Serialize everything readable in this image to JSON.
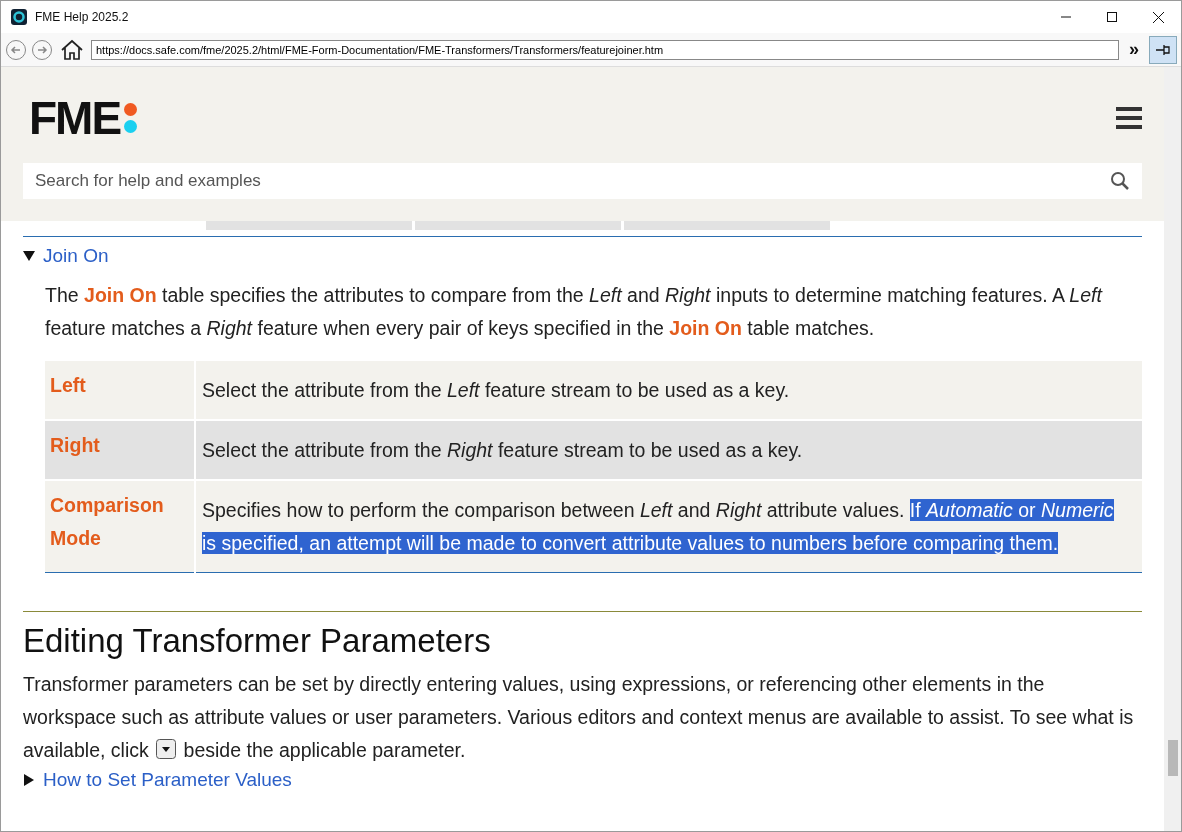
{
  "window": {
    "title": "FME Help 2025.2"
  },
  "toolbar": {
    "url": "https://docs.safe.com/fme/2025.2/html/FME-Form-Documentation/FME-Transformers/Transformers/featurejoiner.htm",
    "overflow": "»"
  },
  "header": {
    "logo": "FME",
    "search": {
      "placeholder": "Search for help and examples"
    }
  },
  "section": {
    "title": "Join On",
    "expanded": true,
    "intro": "The **Join On** table specifies the attributes to compare from the *Left* and *Right* inputs to determine matching features. A *Left* feature matches a *Right* feature when every pair of keys specified in the **Join On** table matches.",
    "rows": [
      {
        "name": "Left",
        "segments": [
          {
            "text": "Select the attribute from the *Left* feature stream to be used as a key.",
            "selected": false
          }
        ]
      },
      {
        "name": "Right",
        "segments": [
          {
            "text": "Select the attribute from the *Right* feature stream to be used as a key.",
            "selected": false
          }
        ]
      },
      {
        "name": "Comparison Mode",
        "segments": [
          {
            "text": "Specifies how to perform the comparison between *Left* and *Right* attribute values. ",
            "selected": false
          },
          {
            "text": "If *Automatic* or *Numeric* is specified, an attempt will be made to convert attribute values to numbers before comparing them.",
            "selected": true
          }
        ]
      }
    ]
  },
  "editing": {
    "heading": "Editing Transformer Parameters",
    "text_before": "Transformer parameters can be set by directly entering values, using expressions, or referencing other elements in the workspace such as attribute values or user parameters. Various editors and context menus are available to assist. To see what is available, click",
    "text_after": "beside the applicable parameter.",
    "link": {
      "title": "How to Set Parameter Values",
      "expanded": false
    }
  }
}
